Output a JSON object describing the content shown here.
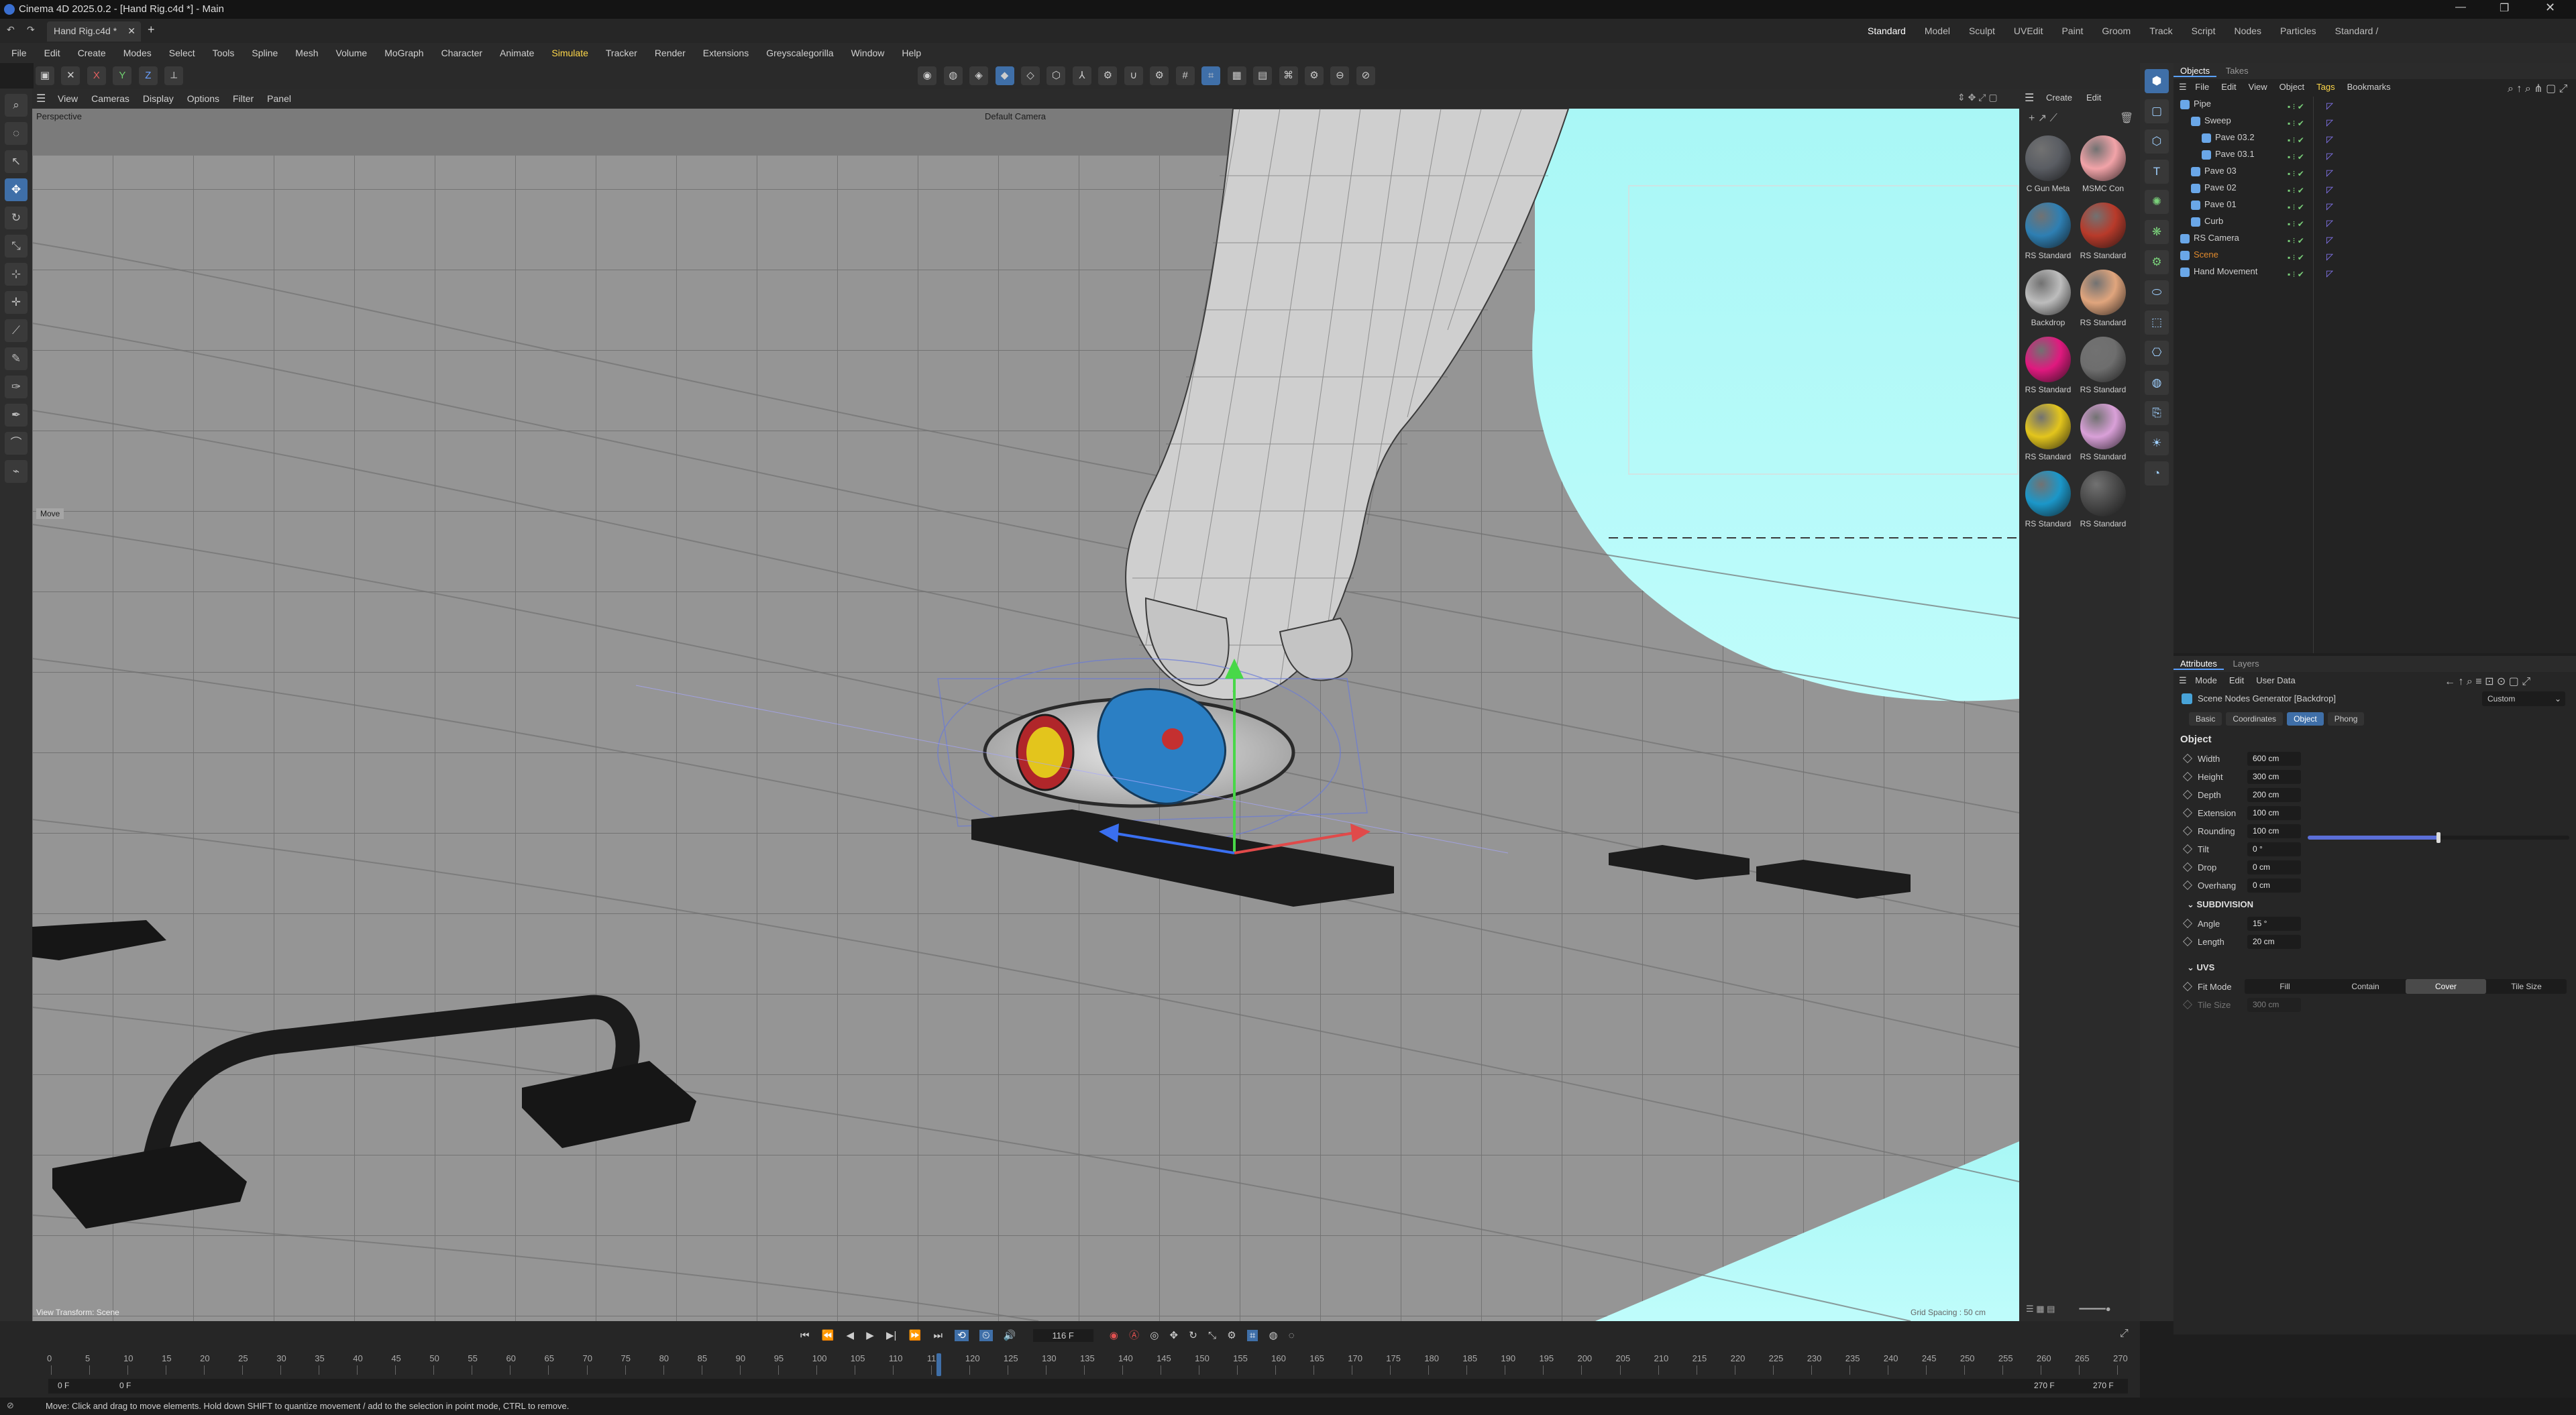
{
  "window": {
    "title": "Cinema 4D 2025.0.2 - [Hand Rig.c4d *] - Main",
    "doc_tab": "Hand Rig.c4d *",
    "new_tab": "+"
  },
  "workspaces": [
    "Standard",
    "Model",
    "Sculpt",
    "UVEdit",
    "Paint",
    "Groom",
    "Track",
    "Script",
    "Nodes",
    "Particles",
    "Standard /"
  ],
  "menu": [
    "File",
    "Edit",
    "Create",
    "Modes",
    "Select",
    "Tools",
    "Spline",
    "Mesh",
    "Volume",
    "MoGraph",
    "Character",
    "Animate",
    "Simulate",
    "Tracker",
    "Render",
    "Extensions",
    "Greyscalegorilla",
    "Window",
    "Help"
  ],
  "axis_toggles": [
    "X",
    "Y",
    "Z"
  ],
  "viewport": {
    "menu": [
      "View",
      "Cameras",
      "Display",
      "Options",
      "Filter",
      "Panel"
    ],
    "label": "Perspective",
    "camera": "Default Camera",
    "hud_move": "Move",
    "view_transform": "View Transform: Scene",
    "grid_spacing": "Grid Spacing : 50 cm"
  },
  "materials": {
    "menu": [
      "Create",
      "Edit"
    ],
    "items": [
      {
        "name": "C Gun Meta",
        "color": "#5a5d63"
      },
      {
        "name": "MSMC Con",
        "color": "#f2a3a8"
      },
      {
        "name": "RS Standard",
        "color": "#2e7fb3"
      },
      {
        "name": "RS Standard",
        "color": "#b83a2a"
      },
      {
        "name": "Backdrop",
        "color": "#bdbdbd"
      },
      {
        "name": "RS Standard",
        "color": "#e0a57d"
      },
      {
        "name": "RS Standard",
        "color": "#e0197f"
      },
      {
        "name": "RS Standard",
        "color": "#6e6e6e"
      },
      {
        "name": "RS Standard",
        "color": "#e3c51c"
      },
      {
        "name": "RS Standard",
        "color": "#d9a0d8"
      },
      {
        "name": "RS Standard",
        "color": "#1b97c9"
      },
      {
        "name": "RS Standard",
        "color": "#4a4a4a"
      }
    ]
  },
  "objects": {
    "tabs": [
      "Objects",
      "Takes"
    ],
    "menu": [
      "File",
      "Edit",
      "View",
      "Object",
      "Tags",
      "Bookmarks"
    ],
    "items": [
      {
        "name": "Pipe",
        "indent": 0,
        "color": "#cfcfcf"
      },
      {
        "name": "Sweep",
        "indent": 1,
        "color": "#cfcfcf"
      },
      {
        "name": "Pave 03.2",
        "indent": 2,
        "color": "#cfcfcf"
      },
      {
        "name": "Pave 03.1",
        "indent": 2,
        "color": "#cfcfcf"
      },
      {
        "name": "Pave 03",
        "indent": 1,
        "color": "#cfcfcf"
      },
      {
        "name": "Pave 02",
        "indent": 1,
        "color": "#cfcfcf"
      },
      {
        "name": "Pave 01",
        "indent": 1,
        "color": "#cfcfcf"
      },
      {
        "name": "Curb",
        "indent": 1,
        "color": "#cfcfcf"
      },
      {
        "name": "RS Camera",
        "indent": 0,
        "color": "#cfcfcf"
      },
      {
        "name": "Scene",
        "indent": 0,
        "color": "#e08a2e"
      },
      {
        "name": "Hand Movement",
        "indent": 0,
        "color": "#cfcfcf"
      }
    ]
  },
  "attributes": {
    "tabs": [
      "Attributes",
      "Layers"
    ],
    "menu": [
      "Mode",
      "Edit",
      "User Data"
    ],
    "object_title": "Scene Nodes Generator [Backdrop]",
    "preset": "Custom",
    "subtabs": [
      "Basic",
      "Coordinates",
      "Object",
      "Phong"
    ],
    "active_subtab": "Object",
    "section": "Object",
    "params": [
      {
        "label": "Width",
        "value": "600 cm"
      },
      {
        "label": "Height",
        "value": "300 cm"
      },
      {
        "label": "Depth",
        "value": "200 cm"
      },
      {
        "label": "Extension",
        "value": "100 cm"
      },
      {
        "label": "Rounding",
        "value": "100 cm"
      }
    ],
    "rounding_slider": 0.5,
    "params2": [
      {
        "label": "Tilt",
        "value": "0 °"
      },
      {
        "label": "Drop",
        "value": "0 cm"
      },
      {
        "label": "Overhang",
        "value": "0 cm"
      }
    ],
    "subdivision_title": "SUBDIVISION",
    "subdivision": [
      {
        "label": "Angle",
        "value": "15 °"
      },
      {
        "label": "Length",
        "value": "20 cm"
      }
    ],
    "uvs_title": "UVS",
    "fit_mode_label": "Fit Mode",
    "fit_modes": [
      "Fill",
      "Contain",
      "Cover",
      "Tile Size"
    ],
    "fit_mode_active": "Cover",
    "tile_size_label": "Tile Size",
    "tile_size_value": "300 cm"
  },
  "timeline": {
    "current_frame": "116 F",
    "ticks": [
      "0",
      "5",
      "10",
      "15",
      "20",
      "25",
      "30",
      "35",
      "40",
      "45",
      "50",
      "55",
      "60",
      "65",
      "70",
      "75",
      "80",
      "85",
      "90",
      "95",
      "100",
      "105",
      "110",
      "115",
      "120",
      "125",
      "130",
      "135",
      "140",
      "145",
      "150",
      "155",
      "160",
      "165",
      "170",
      "175",
      "180",
      "185",
      "190",
      "195",
      "200",
      "205",
      "210",
      "215",
      "220",
      "225",
      "230",
      "235",
      "240",
      "245",
      "250",
      "255",
      "260",
      "265",
      "270"
    ],
    "playhead_frame": 116,
    "max_frame": 270,
    "start_a": "0 F",
    "start_b": "0 F",
    "end_a": "270 F",
    "end_b": "270 F"
  },
  "status": "Move: Click and drag to move elements. Hold down SHIFT to quantize movement / add to the selection in point mode, CTRL to remove."
}
